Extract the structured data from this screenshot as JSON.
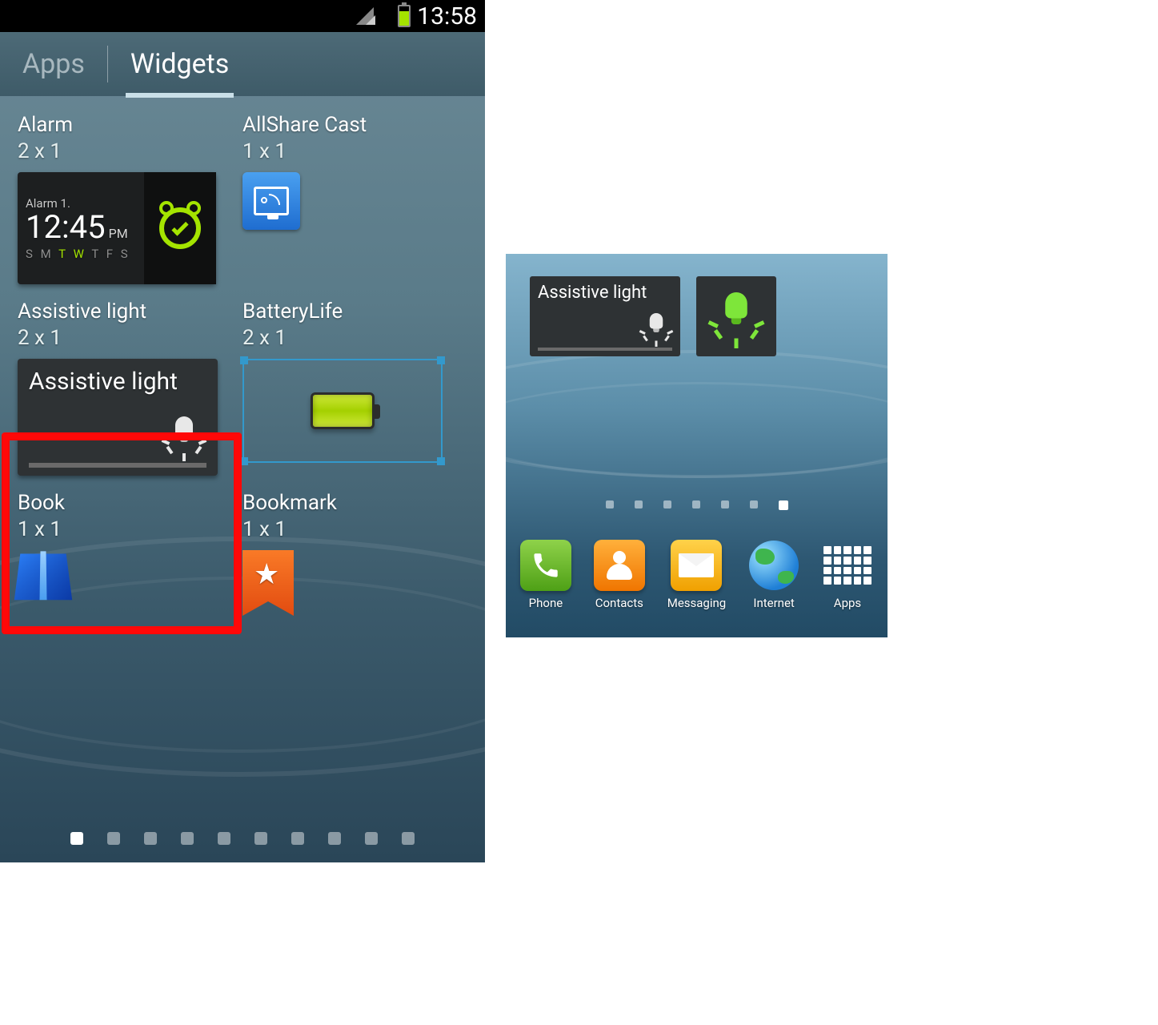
{
  "left": {
    "statusbar": {
      "time": "13:58"
    },
    "tabs": {
      "apps": "Apps",
      "widgets": "Widgets",
      "active": "widgets"
    },
    "widgets": [
      {
        "name": "Alarm",
        "size": "2 x 1",
        "alarm": {
          "label": "Alarm 1.",
          "hour": "12:",
          "min": "45",
          "ampm": "PM",
          "days": [
            "S",
            "M",
            "T",
            "W",
            "T",
            "F",
            "S"
          ],
          "active_days": [
            2,
            3
          ]
        }
      },
      {
        "name": "AllShare Cast",
        "size": "1 x 1"
      },
      {
        "name": "Assistive light",
        "size": "2 x 1",
        "widget_label": "Assistive light",
        "highlighted": true
      },
      {
        "name": "BatteryLife",
        "size": "2 x 1"
      },
      {
        "name": "Book",
        "size": "1 x 1"
      },
      {
        "name": "Bookmark",
        "size": "1 x 1"
      }
    ],
    "pager": {
      "count": 10,
      "active": 0
    }
  },
  "right": {
    "assistive_widget_label": "Assistive light",
    "pager": {
      "count": 7,
      "active": 6
    },
    "dock": [
      {
        "label": "Phone"
      },
      {
        "label": "Contacts"
      },
      {
        "label": "Messaging"
      },
      {
        "label": "Internet"
      },
      {
        "label": "Apps"
      }
    ]
  }
}
